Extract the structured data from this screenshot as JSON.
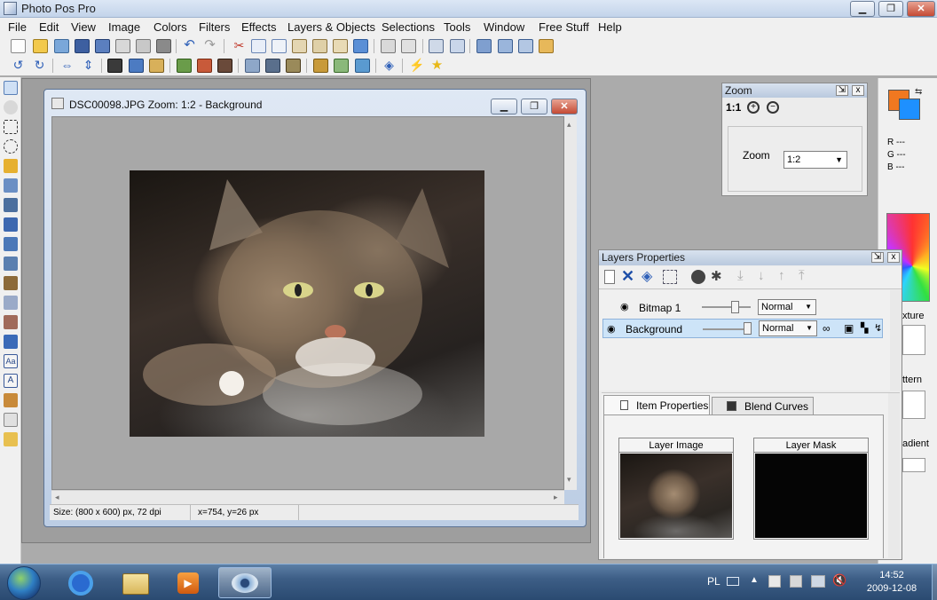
{
  "app": {
    "title": "Photo Pos Pro"
  },
  "window_controls": {
    "minimize": "▁",
    "restore": "❐",
    "close": "✕"
  },
  "menu": [
    "File",
    "Edit",
    "View",
    "Image",
    "Colors",
    "Filters",
    "Effects",
    "Layers & Objects",
    "Selections",
    "Tools",
    "Window",
    "Free Stuff",
    "Help"
  ],
  "document": {
    "title": "DSC00098.JPG  Zoom: 1:2 - Background",
    "status_size": "Size: (800 x 600) px, 72 dpi",
    "status_coords": "x=754, y=26 px"
  },
  "zoom_panel": {
    "title": "Zoom",
    "one_to_one": "1:1",
    "zoom_label": "Zoom",
    "zoom_value": "1:2"
  },
  "color_panel": {
    "r": "R ---",
    "g": "G ---",
    "b": "B ---",
    "texture_label": "xture",
    "pattern_label": "ttern",
    "gradient_label": "adient",
    "foreground": "#f07820",
    "background": "#1e90ff"
  },
  "layers_panel": {
    "title": "Layers Properties",
    "layers": [
      {
        "name": "Bitmap 1",
        "blend": "Normal",
        "selected": false
      },
      {
        "name": "Background",
        "blend": "Normal",
        "selected": true
      }
    ],
    "tabs": [
      "Item Properties",
      "Blend Curves"
    ],
    "layer_image_label": "Layer Image",
    "layer_mask_label": "Layer Mask"
  },
  "taskbar": {
    "language": "PL",
    "time": "14:52",
    "date": "2009-12-08"
  }
}
